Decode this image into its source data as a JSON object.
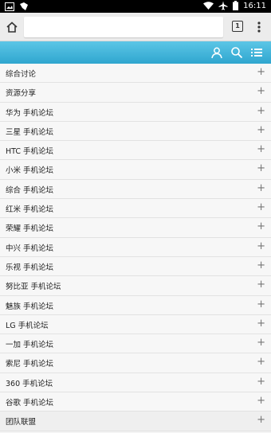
{
  "statusbar": {
    "time": "16:11"
  },
  "browser": {
    "url": "",
    "tab_count": "1"
  },
  "forum": {
    "rows": [
      {
        "label": "综合讨论"
      },
      {
        "label": "资源分享"
      },
      {
        "label": "华为 手机论坛"
      },
      {
        "label": "三星 手机论坛"
      },
      {
        "label": "HTC 手机论坛"
      },
      {
        "label": "小米 手机论坛"
      },
      {
        "label": "综合 手机论坛"
      },
      {
        "label": "红米 手机论坛"
      },
      {
        "label": "荣耀 手机论坛"
      },
      {
        "label": "中兴 手机论坛"
      },
      {
        "label": "乐视 手机论坛"
      },
      {
        "label": "努比亚 手机论坛"
      },
      {
        "label": "魅族 手机论坛"
      },
      {
        "label": "LG 手机论坛"
      },
      {
        "label": "一加 手机论坛"
      },
      {
        "label": "索尼 手机论坛"
      },
      {
        "label": "360 手机论坛"
      },
      {
        "label": "谷歌 手机论坛"
      },
      {
        "label": "团队联盟"
      }
    ],
    "expand_symbol": "+"
  },
  "colors": {
    "header_top": "#5cc6e6",
    "header_bottom": "#2fa6cf",
    "accent": "#2fa6cf"
  }
}
